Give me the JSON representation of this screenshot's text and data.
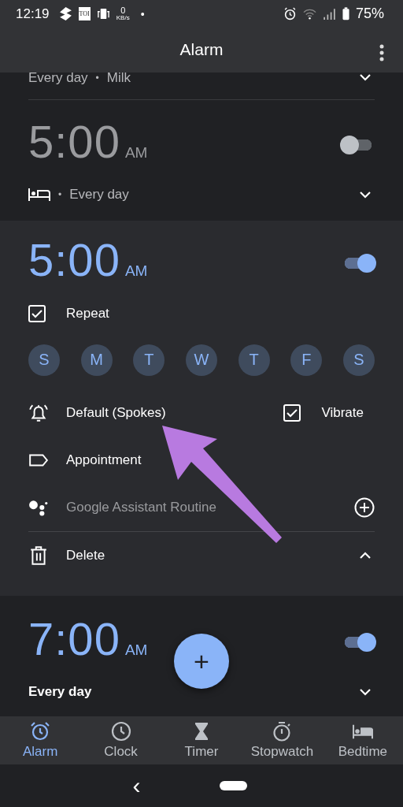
{
  "status_bar": {
    "time": "12:19",
    "toi": "TOI",
    "speed_value": "0",
    "speed_unit": "KB/s",
    "dot": "•",
    "battery": "75%"
  },
  "app_bar": {
    "title": "Alarm"
  },
  "alarms": [
    {
      "kind": "partial",
      "subtitle": "Every day",
      "separator": "•",
      "label": "Milk"
    },
    {
      "kind": "collapsed",
      "time": "5:00",
      "ampm": "AM",
      "on": false,
      "bedtime": true,
      "separator": "•",
      "subtitle": "Every day"
    },
    {
      "kind": "expanded",
      "time": "5:00",
      "ampm": "AM",
      "on": true,
      "repeat": {
        "label": "Repeat",
        "checked": true
      },
      "days": [
        {
          "label": "S",
          "selected": true
        },
        {
          "label": "M",
          "selected": true
        },
        {
          "label": "T",
          "selected": true
        },
        {
          "label": "W",
          "selected": true
        },
        {
          "label": "T",
          "selected": true
        },
        {
          "label": "F",
          "selected": true
        },
        {
          "label": "S",
          "selected": true
        }
      ],
      "ringtone": "Default (Spokes)",
      "vibrate": {
        "label": "Vibrate",
        "checked": true
      },
      "label": "Appointment",
      "assistant": "Google Assistant Routine",
      "delete": "Delete"
    },
    {
      "kind": "collapsed",
      "time": "7:00",
      "ampm": "AM",
      "on": true,
      "bedtime": false,
      "subtitle": "Every day"
    }
  ],
  "fab": {
    "symbol": "+"
  },
  "tabs": [
    {
      "label": "Alarm",
      "selected": true
    },
    {
      "label": "Clock",
      "selected": false
    },
    {
      "label": "Timer",
      "selected": false
    },
    {
      "label": "Stopwatch",
      "selected": false
    },
    {
      "label": "Bedtime",
      "selected": false
    }
  ],
  "system_nav": {
    "back": "‹"
  }
}
